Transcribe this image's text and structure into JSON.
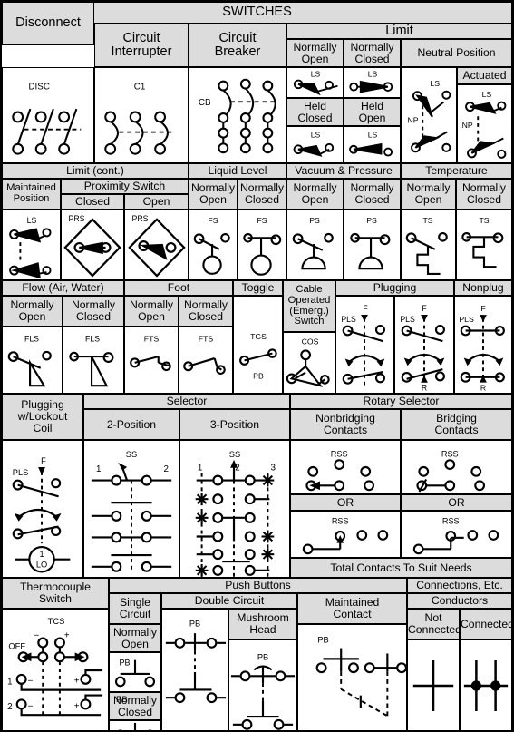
{
  "title": "SWITCHES",
  "sections": {
    "disconnect": {
      "label": "Disconnect",
      "symbol_label": "DISC"
    },
    "circuit_interrupter": {
      "label": "Circuit\nInterrupter",
      "line1": "Circuit",
      "line2": "Interrupter",
      "symbol_label": "C1"
    },
    "circuit_breaker": {
      "line1": "Circuit",
      "line2": "Breaker",
      "symbol_label": "CB"
    },
    "limit": {
      "label": "Limit",
      "normally_open": {
        "line1": "Normally",
        "line2": "Open",
        "symbol_label": "LS"
      },
      "normally_closed": {
        "line1": "Normally",
        "line2": "Closed",
        "symbol_label": "LS"
      },
      "held_closed": {
        "line1": "Held",
        "line2": "Closed",
        "symbol_label": "LS"
      },
      "held_open": {
        "line1": "Held",
        "line2": "Open",
        "symbol_label": "LS"
      },
      "neutral_position": {
        "label": "Neutral Position",
        "symbol_label": "LS",
        "symbol_label2": "NP"
      },
      "actuated": {
        "label": "Actuated",
        "symbol_label": "LS",
        "symbol_label2": "NP"
      }
    },
    "limit_cont": {
      "label": "Limit (cont.)",
      "maintained_position": {
        "line1": "Maintained",
        "line2": "Position",
        "symbol_label": "LS"
      },
      "proximity_switch": {
        "label": "Proximity Switch"
      },
      "proximity_closed": {
        "label": "Closed",
        "symbol_label": "PRS"
      },
      "proximity_open": {
        "label": "Open",
        "symbol_label": "PRS"
      }
    },
    "liquid_level": {
      "label": "Liquid Level",
      "normally_open": {
        "line1": "Normally",
        "line2": "Open",
        "symbol_label": "FS"
      },
      "normally_closed": {
        "line1": "Normally",
        "line2": "Closed",
        "symbol_label": "FS"
      }
    },
    "vacuum_pressure": {
      "label": "Vacuum & Pressure",
      "normally_open": {
        "line1": "Normally",
        "line2": "Open",
        "symbol_label": "PS"
      },
      "normally_closed": {
        "line1": "Normally",
        "line2": "Closed",
        "symbol_label": "PS"
      }
    },
    "temperature": {
      "label": "Temperature",
      "normally_open": {
        "line1": "Normally",
        "line2": "Open",
        "symbol_label": "TS"
      },
      "normally_closed": {
        "line1": "Normally",
        "line2": "Closed",
        "symbol_label": "TS"
      }
    },
    "flow": {
      "label": "Flow (Air, Water)",
      "normally_open": {
        "line1": "Normally",
        "line2": "Open",
        "symbol_label": "FLS"
      },
      "normally_closed": {
        "line1": "Normally",
        "line2": "Closed",
        "symbol_label": "FLS"
      }
    },
    "foot": {
      "label": "Foot",
      "normally_open": {
        "line1": "Normally",
        "line2": "Open",
        "symbol_label": "FTS"
      },
      "normally_closed": {
        "line1": "Normally",
        "line2": "Closed",
        "symbol_label": "FTS"
      }
    },
    "toggle": {
      "label": "Toggle",
      "symbol_label": "TGS",
      "symbol_label2": "PB"
    },
    "cable_operated": {
      "line1": "Cable",
      "line2": "Operated",
      "line3": "(Emerg.)",
      "line4": "Switch",
      "symbol_label": "COS"
    },
    "plugging": {
      "label": "Plugging",
      "a": {
        "label_f": "F",
        "label_pls": "PLS"
      },
      "b": {
        "label_f": "F",
        "label_pls": "PLS",
        "label_r": "R"
      }
    },
    "nonplug": {
      "label": "Nonplug",
      "label_f": "F",
      "label_pls": "PLS",
      "label_r": "R"
    },
    "plugging_lockout": {
      "line1": "Plugging",
      "line2": "w/Lockout",
      "line3": "Coil",
      "label_f": "F",
      "label_pls": "PLS",
      "coil_num": "1",
      "coil_txt": "LO"
    },
    "selector": {
      "label": "Selector",
      "two_position": {
        "label": "2-Position",
        "symbol_label": "SS",
        "pos1": "1",
        "pos2": "2"
      },
      "three_position": {
        "label": "3-Position",
        "symbol_label": "SS",
        "pos1": "1",
        "pos2": "2",
        "pos3": "3"
      }
    },
    "rotary_selector": {
      "label": "Rotary Selector",
      "nonbridging": {
        "line1": "Nonbridging",
        "line2": "Contacts",
        "symbol_label": "RSS",
        "or_label": "OR",
        "symbol_label2": "RSS"
      },
      "bridging": {
        "line1": "Bridging",
        "line2": "Contacts",
        "symbol_label": "RSS",
        "or_label": "OR",
        "symbol_label2": "RSS"
      },
      "footer": "Total Contacts To Suit Needs"
    },
    "thermocouple": {
      "line1": "Thermocouple",
      "line2": "Switch",
      "symbol_label": "TCS",
      "off": "OFF",
      "row1": "1",
      "row2": "2",
      "minus": "−",
      "plus": "+"
    },
    "push_buttons": {
      "label": "Push Buttons",
      "single_circuit": {
        "line1": "Single",
        "line2": "Circuit",
        "no_line1": "Normally",
        "no_line2": "Open",
        "no_symbol": "PB",
        "nc_line1": "Normally",
        "nc_line2": "Closed",
        "nc_symbol": "PB"
      },
      "double_circuit": {
        "label": "Double Circuit",
        "symbol_label": "PB"
      },
      "mushroom_head": {
        "line1": "Mushroom",
        "line2": "Head",
        "symbol_label": "PB"
      },
      "maintained_contact": {
        "line1": "Maintained",
        "line2": "Contact",
        "symbol_label": "PB"
      }
    },
    "connections": {
      "label": "Connections, Etc.",
      "conductors": "Conductors",
      "not_connected": {
        "line1": "Not",
        "line2": "Connected"
      },
      "connected": {
        "label": "Connected"
      }
    }
  }
}
